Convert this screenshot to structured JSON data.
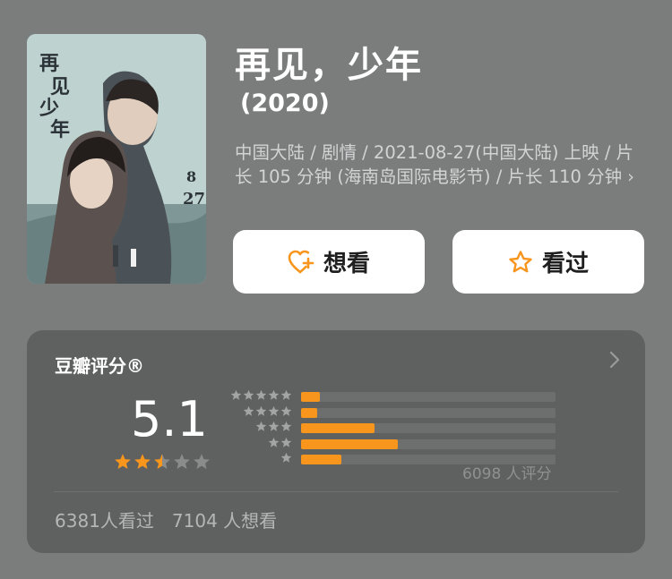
{
  "movie": {
    "title": "再见，少年",
    "year": "(2020)",
    "meta": "中国大陆 / 剧情 / 2021-08-27(中国大陆) 上映 / 片长 105 分钟 (海南岛国际电影节) / 片长 110 分钟",
    "meta_chevron": "›",
    "poster": {
      "title_chars": "再见少年",
      "date": "8/27"
    }
  },
  "actions": {
    "want_label": "想看",
    "seen_label": "看过"
  },
  "rating": {
    "title": "豆瓣评分®",
    "score": "5.1",
    "stars_value": 2.5,
    "distribution": [
      {
        "stars": 5,
        "percent": 7.5
      },
      {
        "stars": 4,
        "percent": 6.5
      },
      {
        "stars": 3,
        "percent": 29
      },
      {
        "stars": 2,
        "percent": 38
      },
      {
        "stars": 1,
        "percent": 16
      }
    ],
    "count_text": "6098 人评分",
    "seen_text": "6381人看过",
    "want_text": "7104 人想看"
  },
  "colors": {
    "background": "#7b7d7d",
    "card": "#5f6161",
    "accent": "#f8951d",
    "button_bg": "#ffffff"
  },
  "icons": {
    "want": "heart-plus-icon",
    "seen": "star-outline-icon",
    "chevron": "chevron-right-icon"
  }
}
